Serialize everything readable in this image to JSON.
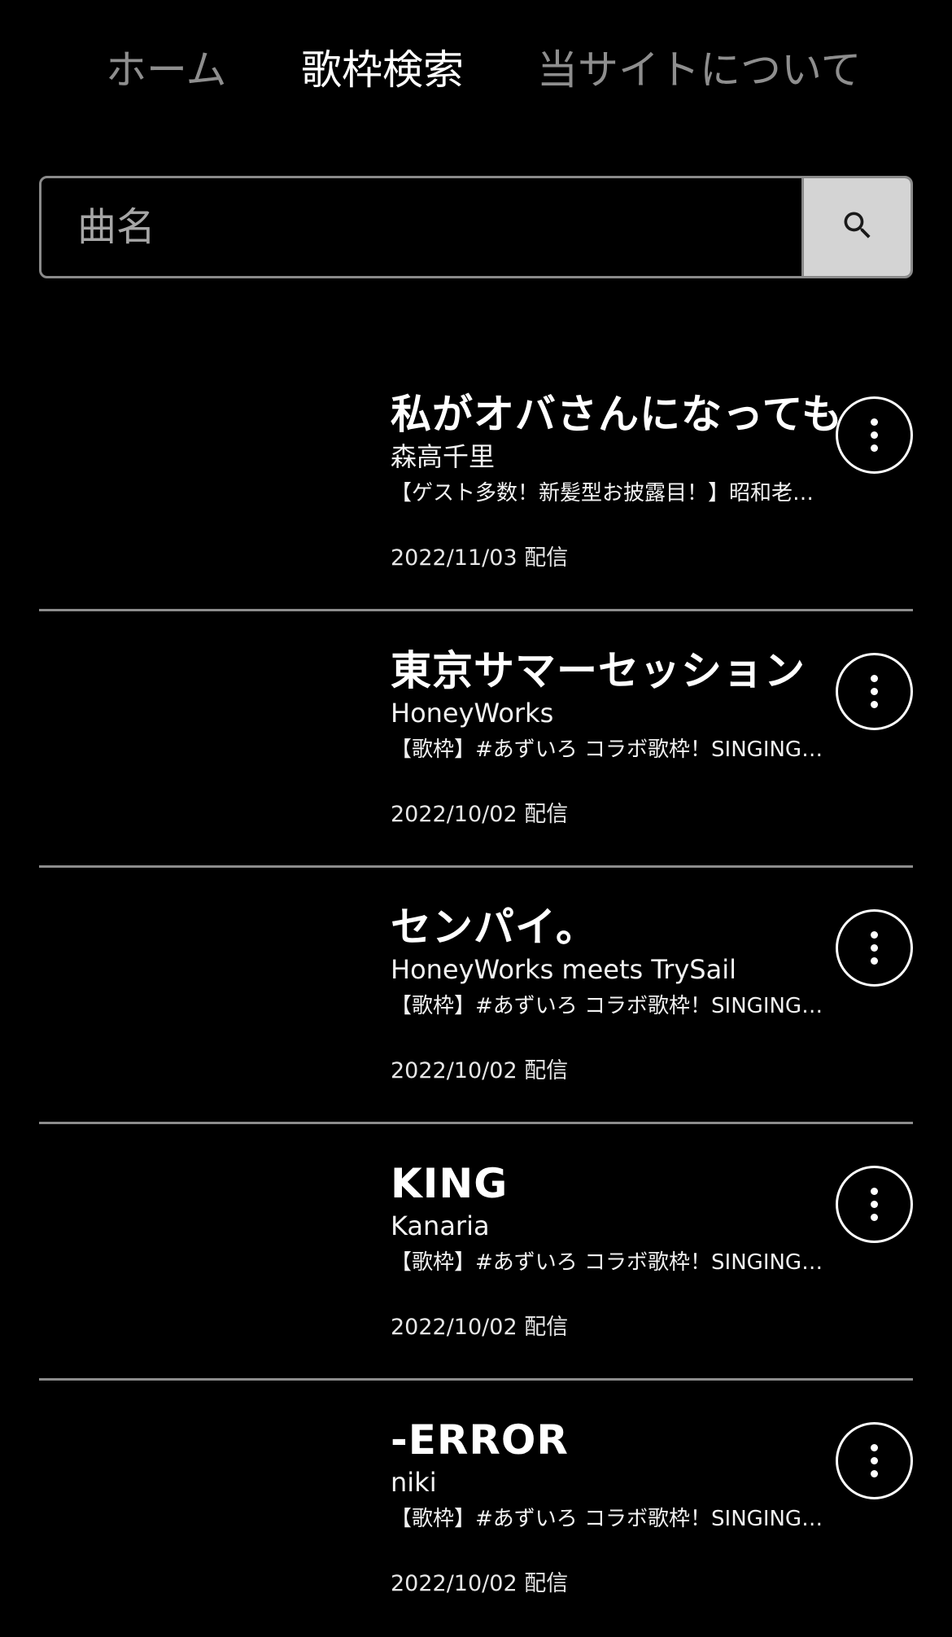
{
  "nav": {
    "home": "ホーム",
    "search": "歌枠検索",
    "about": "当サイトについて"
  },
  "search": {
    "placeholder": "曲名",
    "value": "",
    "button_icon": "search-icon"
  },
  "results": [
    {
      "title": "私がオバさんになっても",
      "artist": "森高千里",
      "stream_title": "【ゲスト多数！新髪型お披露目！】昭和老…",
      "date": "2022/11/03 配信"
    },
    {
      "title": "東京サマーセッション",
      "artist": "HoneyWorks",
      "stream_title": "【歌枠】#あずいろ コラボ歌枠！SINGING…",
      "date": "2022/10/02 配信"
    },
    {
      "title": "センパイ。",
      "artist": "HoneyWorks meets TrySail",
      "stream_title": "【歌枠】#あずいろ コラボ歌枠！SINGING…",
      "date": "2022/10/02 配信"
    },
    {
      "title": "KING",
      "artist": "Kanaria",
      "stream_title": "【歌枠】#あずいろ コラボ歌枠！SINGING…",
      "date": "2022/10/02 配信"
    },
    {
      "title": "-ERROR",
      "artist": "niki",
      "stream_title": "【歌枠】#あずいろ コラボ歌枠！SINGING…",
      "date": "2022/10/02 配信"
    }
  ],
  "colors": {
    "background": "#000000",
    "text": "#ffffff",
    "nav_inactive": "#8e8e8e",
    "search_button_bg": "#d4d4d4",
    "divider": "#8c8c8c"
  }
}
